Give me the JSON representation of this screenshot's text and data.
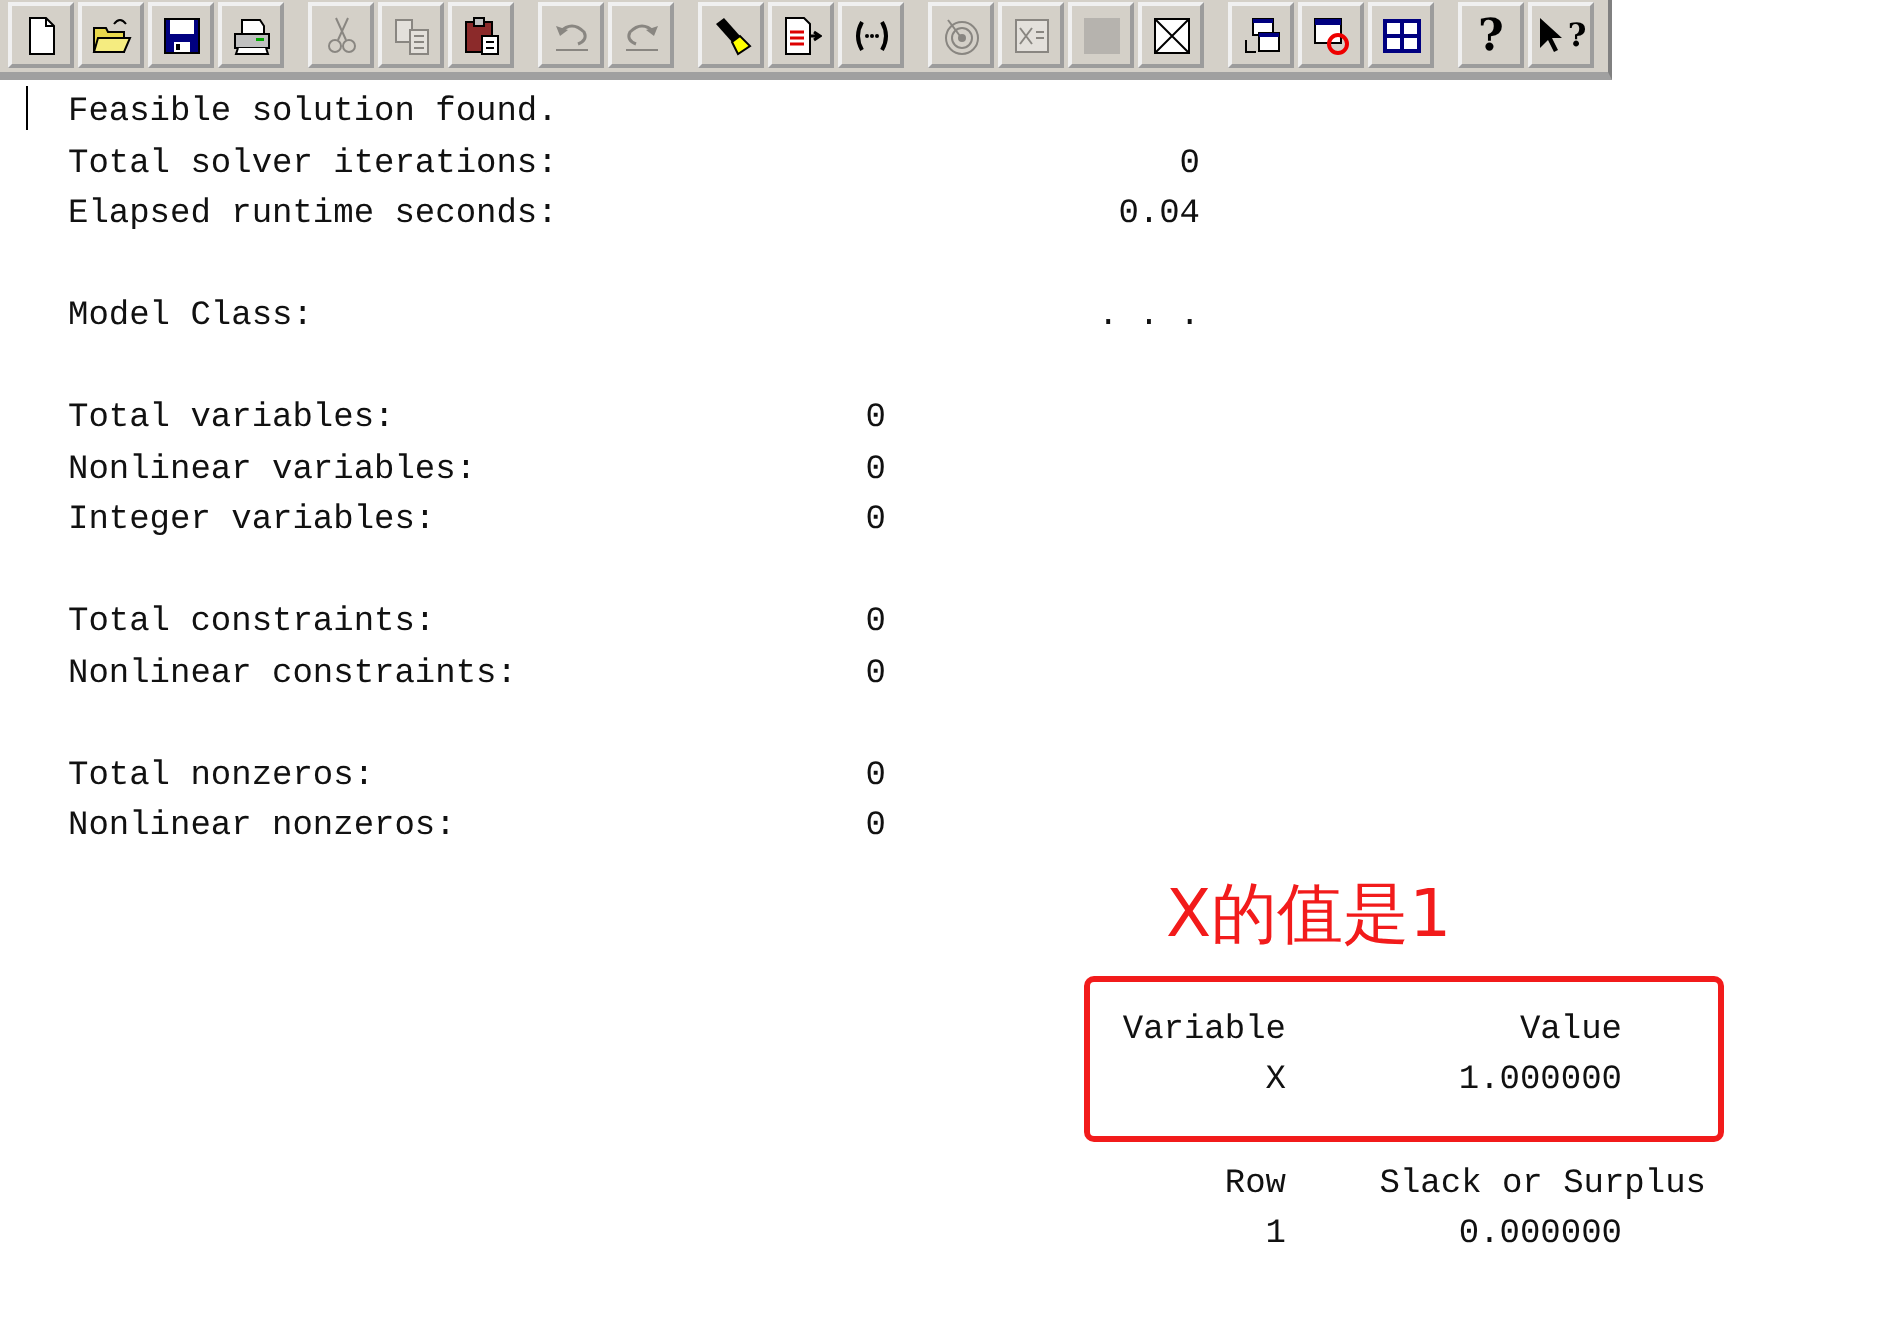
{
  "toolbar": {
    "groups": [
      {
        "buttons": [
          {
            "kind": "page",
            "disabled": false
          },
          {
            "kind": "folder",
            "disabled": false
          },
          {
            "kind": "floppy",
            "disabled": false
          },
          {
            "kind": "printer",
            "disabled": false
          }
        ]
      },
      {
        "buttons": [
          {
            "kind": "scissors",
            "disabled": true
          },
          {
            "kind": "pages",
            "disabled": true
          },
          {
            "kind": "clipboard",
            "disabled": false
          }
        ]
      },
      {
        "buttons": [
          {
            "kind": "undo",
            "disabled": true
          },
          {
            "kind": "redo",
            "disabled": true
          }
        ]
      },
      {
        "buttons": [
          {
            "kind": "flashlight",
            "disabled": false
          },
          {
            "kind": "pagearrow",
            "disabled": false
          },
          {
            "kind": "parens",
            "disabled": false
          }
        ]
      },
      {
        "buttons": [
          {
            "kind": "target",
            "disabled": true
          },
          {
            "kind": "pagex",
            "disabled": true
          },
          {
            "kind": "square",
            "disabled": true
          },
          {
            "kind": "boxedx",
            "disabled": false
          }
        ]
      },
      {
        "buttons": [
          {
            "kind": "windows",
            "disabled": false
          },
          {
            "kind": "windowstop",
            "disabled": false
          },
          {
            "kind": "grid",
            "disabled": false
          }
        ]
      },
      {
        "buttons": [
          {
            "kind": "help",
            "label": "?",
            "disabled": false
          },
          {
            "kind": "pointerhelp",
            "label": "?",
            "disabled": false
          }
        ]
      }
    ]
  },
  "report": {
    "sections": [
      {
        "kind": "wide",
        "rows": [
          {
            "label": "Feasible solution found."
          },
          {
            "label": "Total solver iterations:",
            "value": "0"
          },
          {
            "label": "Elapsed runtime seconds:",
            "value": "0.04"
          }
        ]
      },
      {
        "kind": "wide",
        "rows": [
          {
            "label": "Model Class:",
            "value": ". . ."
          }
        ]
      },
      {
        "kind": "narrow",
        "rows": [
          {
            "label": "Total variables:",
            "value": "0"
          },
          {
            "label": "Nonlinear variables:",
            "value": "0"
          },
          {
            "label": "Integer variables:",
            "value": "0"
          }
        ]
      },
      {
        "kind": "narrow",
        "rows": [
          {
            "label": "Total constraints:",
            "value": "0"
          },
          {
            "label": "Nonlinear constraints:",
            "value": "0"
          }
        ]
      },
      {
        "kind": "narrow",
        "rows": [
          {
            "label": "Total nonzeros:",
            "value": "0"
          },
          {
            "label": "Nonlinear nonzeros:",
            "value": "0"
          }
        ]
      }
    ]
  },
  "annotation": {
    "text": "X的值是1"
  },
  "variables_table": {
    "columns": [
      "Variable",
      "Value"
    ],
    "rows": [
      [
        "X",
        "1.000000"
      ]
    ]
  },
  "rows_table": {
    "columns": [
      "Row",
      "Slack or Surplus"
    ],
    "rows": [
      [
        "1",
        "0.000000"
      ]
    ]
  }
}
